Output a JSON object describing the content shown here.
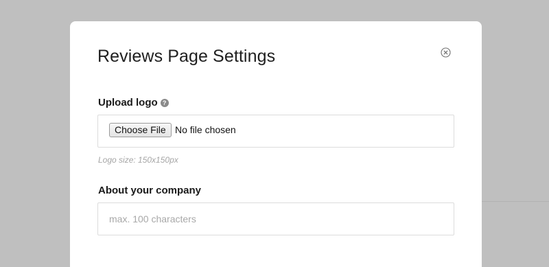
{
  "modal": {
    "title": "Reviews Page Settings",
    "close_icon": "close-circle-icon"
  },
  "upload_logo": {
    "label": "Upload logo",
    "help_icon": "question-circle-icon",
    "help_glyph": "?",
    "button_label": "Choose File",
    "file_status": "No file chosen",
    "hint": "Logo size: 150x150px"
  },
  "about_company": {
    "label": "About your company",
    "value": "",
    "placeholder": "max. 100 characters"
  },
  "colors": {
    "backdrop": "#bfbfbf",
    "modal_background": "#ffffff",
    "field_border": "#dcdcdc",
    "hint_text": "#a5a5a5"
  }
}
